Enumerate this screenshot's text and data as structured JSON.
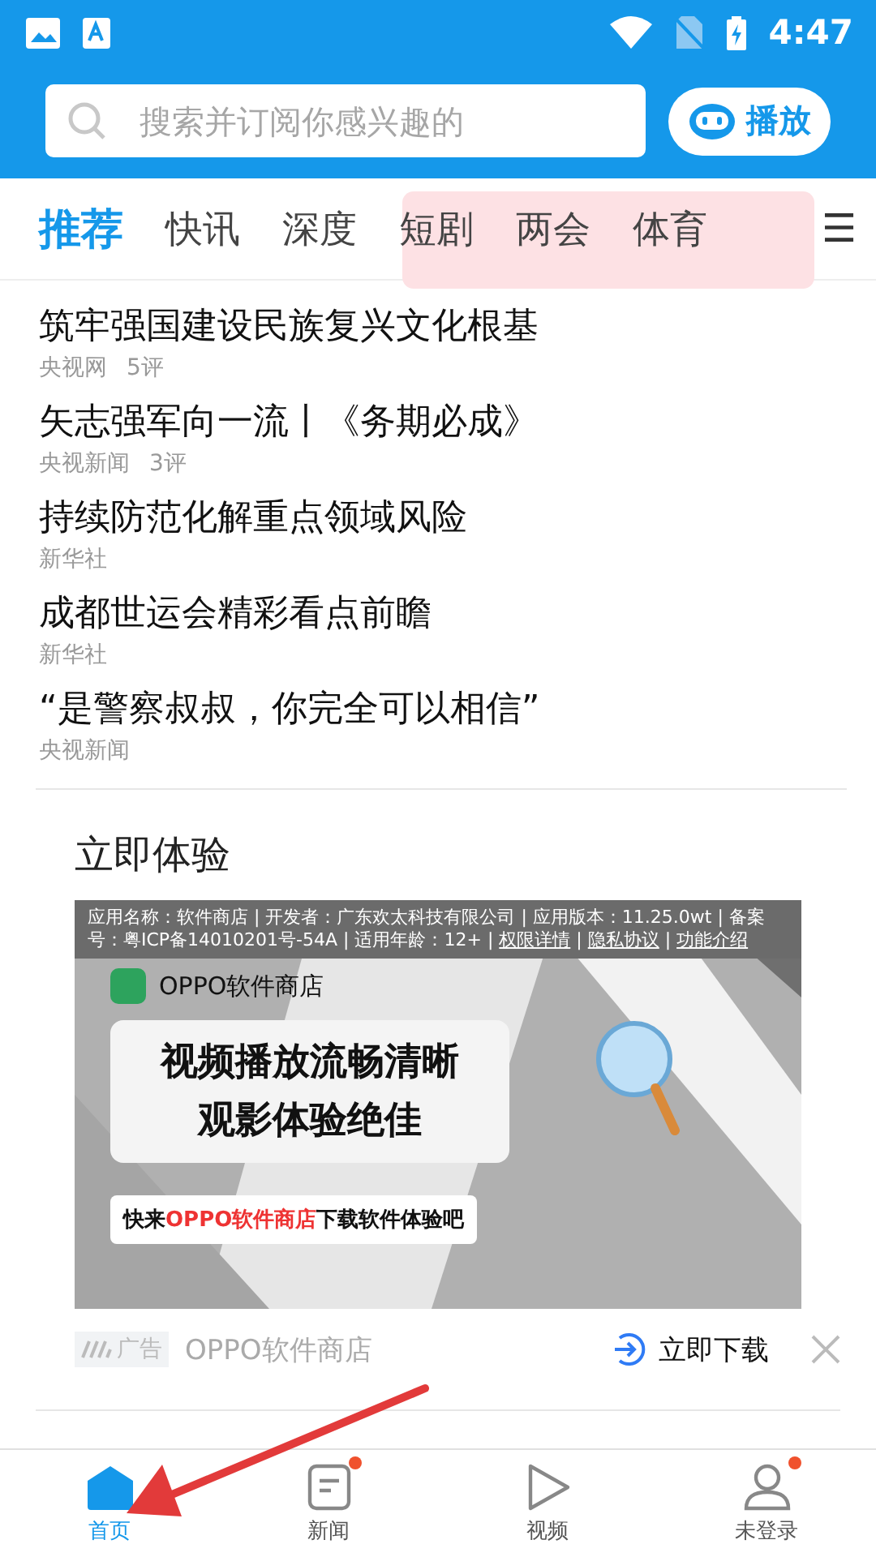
{
  "status_bar": {
    "time": "4:47"
  },
  "search": {
    "placeholder": "搜索并订阅你感兴趣的"
  },
  "play_button": {
    "label": "播放"
  },
  "tabs": [
    {
      "label": "推荐",
      "selected": true
    },
    {
      "label": "快讯",
      "selected": false
    },
    {
      "label": "深度",
      "selected": false
    },
    {
      "label": "短剧",
      "selected": false
    },
    {
      "label": "两会",
      "selected": false
    },
    {
      "label": "体育",
      "selected": false
    }
  ],
  "menu_icon": "☰",
  "news": [
    {
      "title": "筑牢强国建设民族复兴文化根基",
      "source": "央视网",
      "comments": "5评"
    },
    {
      "title": "矢志强军向一流丨《务期必成》",
      "source": "央视新闻",
      "comments": "3评"
    },
    {
      "title": "持续防范化解重点领域风险",
      "source": "新华社"
    },
    {
      "title": "成都世运会精彩看点前瞻",
      "source": "新华社"
    },
    {
      "title": "“是警察叔叔，你完全可以相信”",
      "source": "央视新闻"
    }
  ],
  "ad": {
    "title": "立即体验",
    "disclosure": "应用名称：软件商店 | 开发者：广东欢太科技有限公司 | 应用版本：11.25.0wt | 备案号：粤ICP备14010201号-54A | 适用年龄：12+ |",
    "disclosure_links": [
      "权限详情",
      "隐私协议",
      "功能介绍"
    ],
    "link_separator": "|",
    "store_name": "OPPO软件商店",
    "headline_lines": [
      "视频播放流畅清晰",
      "观影体验绝佳"
    ],
    "slogan": "快来**OPPO软件商店**下载软件体验吧",
    "ad_label": "广告",
    "advertiser": "OPPO软件商店",
    "download": "立即下载"
  },
  "bottom_nav": [
    {
      "label": "首页",
      "selected": true,
      "badge": false
    },
    {
      "label": "新闻",
      "selected": false,
      "badge": true
    },
    {
      "label": "视频",
      "selected": false,
      "badge": false
    },
    {
      "label": "未登录",
      "selected": false,
      "badge": true
    }
  ]
}
